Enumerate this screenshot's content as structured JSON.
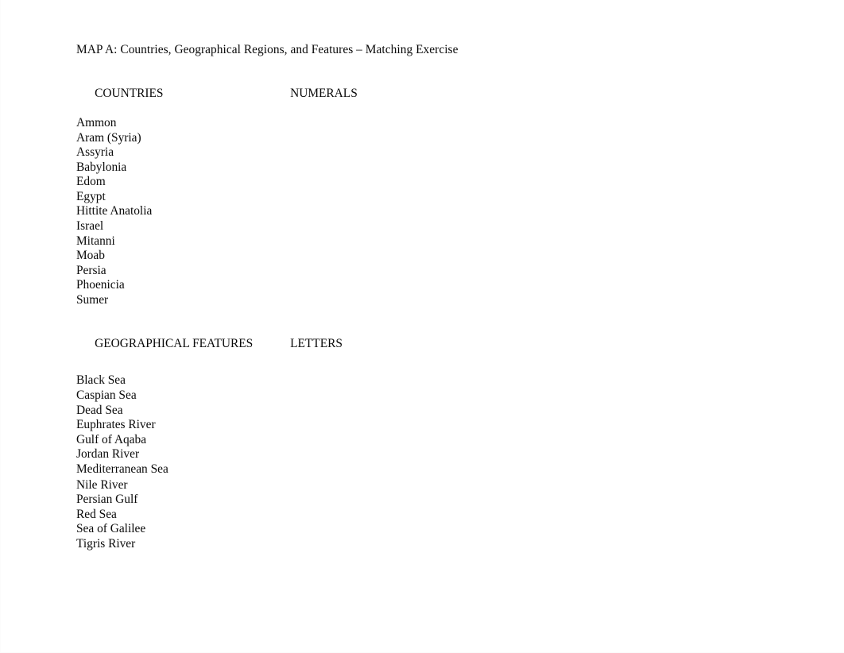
{
  "document": {
    "title": "MAP A: Countries, Geographical Regions, and Features – Matching Exercise",
    "background_color": "#ffffff",
    "text_color": "#0a0a0a"
  },
  "countries_section": {
    "header_left": "COUNTRIES",
    "header_right": "NUMERALS",
    "items": [
      "Ammon",
      "Aram (Syria)",
      "Assyria",
      "Babylonia",
      "Edom",
      "Egypt",
      "Hittite Anatolia",
      "Israel",
      "Mitanni",
      "Moab",
      "Persia",
      "Phoenicia",
      "Sumer"
    ]
  },
  "features_section": {
    "header_left": "GEOGRAPHICAL FEATURES",
    "header_right": "LETTERS",
    "items": [
      "Black Sea",
      "Caspian Sea",
      "Dead Sea",
      "Euphrates River",
      "Gulf of Aqaba",
      "Jordan River",
      "Mediterranean Sea",
      "Nile River",
      "Persian Gulf",
      "Red Sea",
      "Sea of Galilee",
      "Tigris River"
    ]
  }
}
